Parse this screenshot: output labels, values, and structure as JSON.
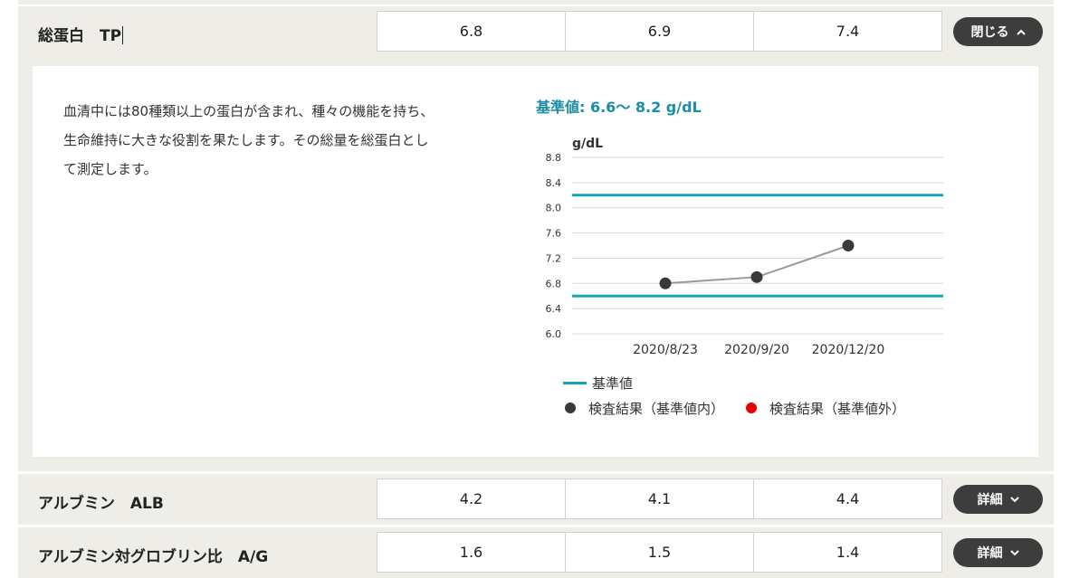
{
  "rows": [
    {
      "label": "総蛋白　TP",
      "values": [
        "6.8",
        "6.9",
        "7.4"
      ],
      "button": "閉じる",
      "button_chevron": "up"
    },
    {
      "label": "アルブミン　ALB",
      "values": [
        "4.2",
        "4.1",
        "4.4"
      ],
      "button": "詳細",
      "button_chevron": "down"
    },
    {
      "label": "アルブミン対グロブリン比　A/G",
      "values": [
        "1.6",
        "1.5",
        "1.4"
      ],
      "button": "詳細",
      "button_chevron": "down"
    }
  ],
  "panel": {
    "description_lines": [
      "血清中には80種類以上の蛋白が含まれ、種々の機能を持ち、",
      "生命維持に大きな役割を果たします。その総量を総蛋白とし",
      "て測定します。"
    ],
    "reference_title": "基準値: 6.6〜 8.2 g/dL"
  },
  "legend": {
    "reference": "基準値",
    "within": "検査結果（基準値内）",
    "outside": "検査結果（基準値外）"
  },
  "colors": {
    "reference_line": "#12a6b5",
    "point_within": "#3a3a3a",
    "point_outside": "#e60000",
    "title_accent": "#1a8ea6"
  },
  "chart_data": {
    "type": "line",
    "ylabel": "g/dL",
    "ylim": [
      6.0,
      8.8
    ],
    "yticks": [
      "6.0",
      "6.4",
      "6.8",
      "7.2",
      "7.6",
      "8.0",
      "8.4",
      "8.8"
    ],
    "categories": [
      "2020/8/23",
      "2020/9/20",
      "2020/12/20"
    ],
    "values": [
      6.8,
      6.9,
      7.4
    ],
    "reference_range": [
      6.6,
      8.2
    ],
    "grid": true
  }
}
